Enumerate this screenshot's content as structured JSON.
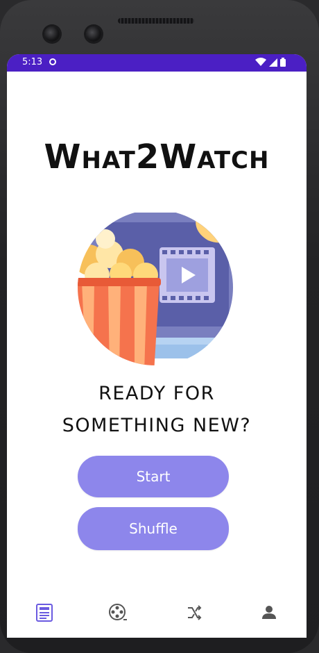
{
  "status_bar": {
    "time": "5:13",
    "color": "#4b1fc4"
  },
  "app": {
    "title": "What2Watch",
    "tagline_line1": "READY FOR",
    "tagline_line2": "SOMETHING NEW?"
  },
  "buttons": {
    "start_label": "Start",
    "shuffle_label": "Shuffle",
    "color": "#8d86eb"
  },
  "bottom_nav": {
    "items": [
      {
        "icon": "list-icon",
        "active": true
      },
      {
        "icon": "film-reel-icon",
        "active": false
      },
      {
        "icon": "shuffle-icon",
        "active": false
      },
      {
        "icon": "person-icon",
        "active": false
      }
    ],
    "active_color": "#6a5ae0",
    "inactive_color": "#555555"
  }
}
